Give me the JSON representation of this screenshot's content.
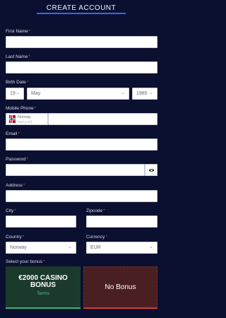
{
  "header": {
    "title": "CREATE ACCOUNT"
  },
  "form": {
    "first_name": {
      "label": "First Name",
      "req": "*",
      "value": ""
    },
    "last_name": {
      "label": "Last Name",
      "req": "*",
      "value": ""
    },
    "birth_date": {
      "label": "Birth Date",
      "req": "*",
      "day": "19",
      "month": "May",
      "year": "1985"
    },
    "mobile_phone": {
      "label": "Mobile Phone",
      "req": "*",
      "country": "Norway",
      "code": "Prof (+47)",
      "value": ""
    },
    "email": {
      "label": "Email",
      "req": "*",
      "value": ""
    },
    "password": {
      "label": "Password",
      "req": "*",
      "value": ""
    },
    "address": {
      "label": "Address",
      "req": "*",
      "value": ""
    },
    "city": {
      "label": "City",
      "req": "*",
      "value": ""
    },
    "zipcode": {
      "label": "Zipcode",
      "req": "*",
      "value": ""
    },
    "country": {
      "label": "Country",
      "req": "*",
      "value": "Norway"
    },
    "currency": {
      "label": "Currency",
      "req": "*",
      "value": "EUR"
    }
  },
  "bonus": {
    "label": "Select your bonus",
    "req": "*",
    "options": [
      {
        "title": "€2000 CASINO BONUS",
        "sub": "Terms"
      },
      {
        "title": "No Bonus"
      }
    ]
  },
  "icons": {
    "eye": "eye-icon",
    "chevron": "chevron-down-icon",
    "flag": "norway-flag-icon"
  },
  "colors": {
    "background": "#0b1030",
    "accent": "#2e6cff",
    "required": "#e0434f",
    "bonus_green": "#1c3a2c",
    "bonus_red": "#4a1f22"
  }
}
